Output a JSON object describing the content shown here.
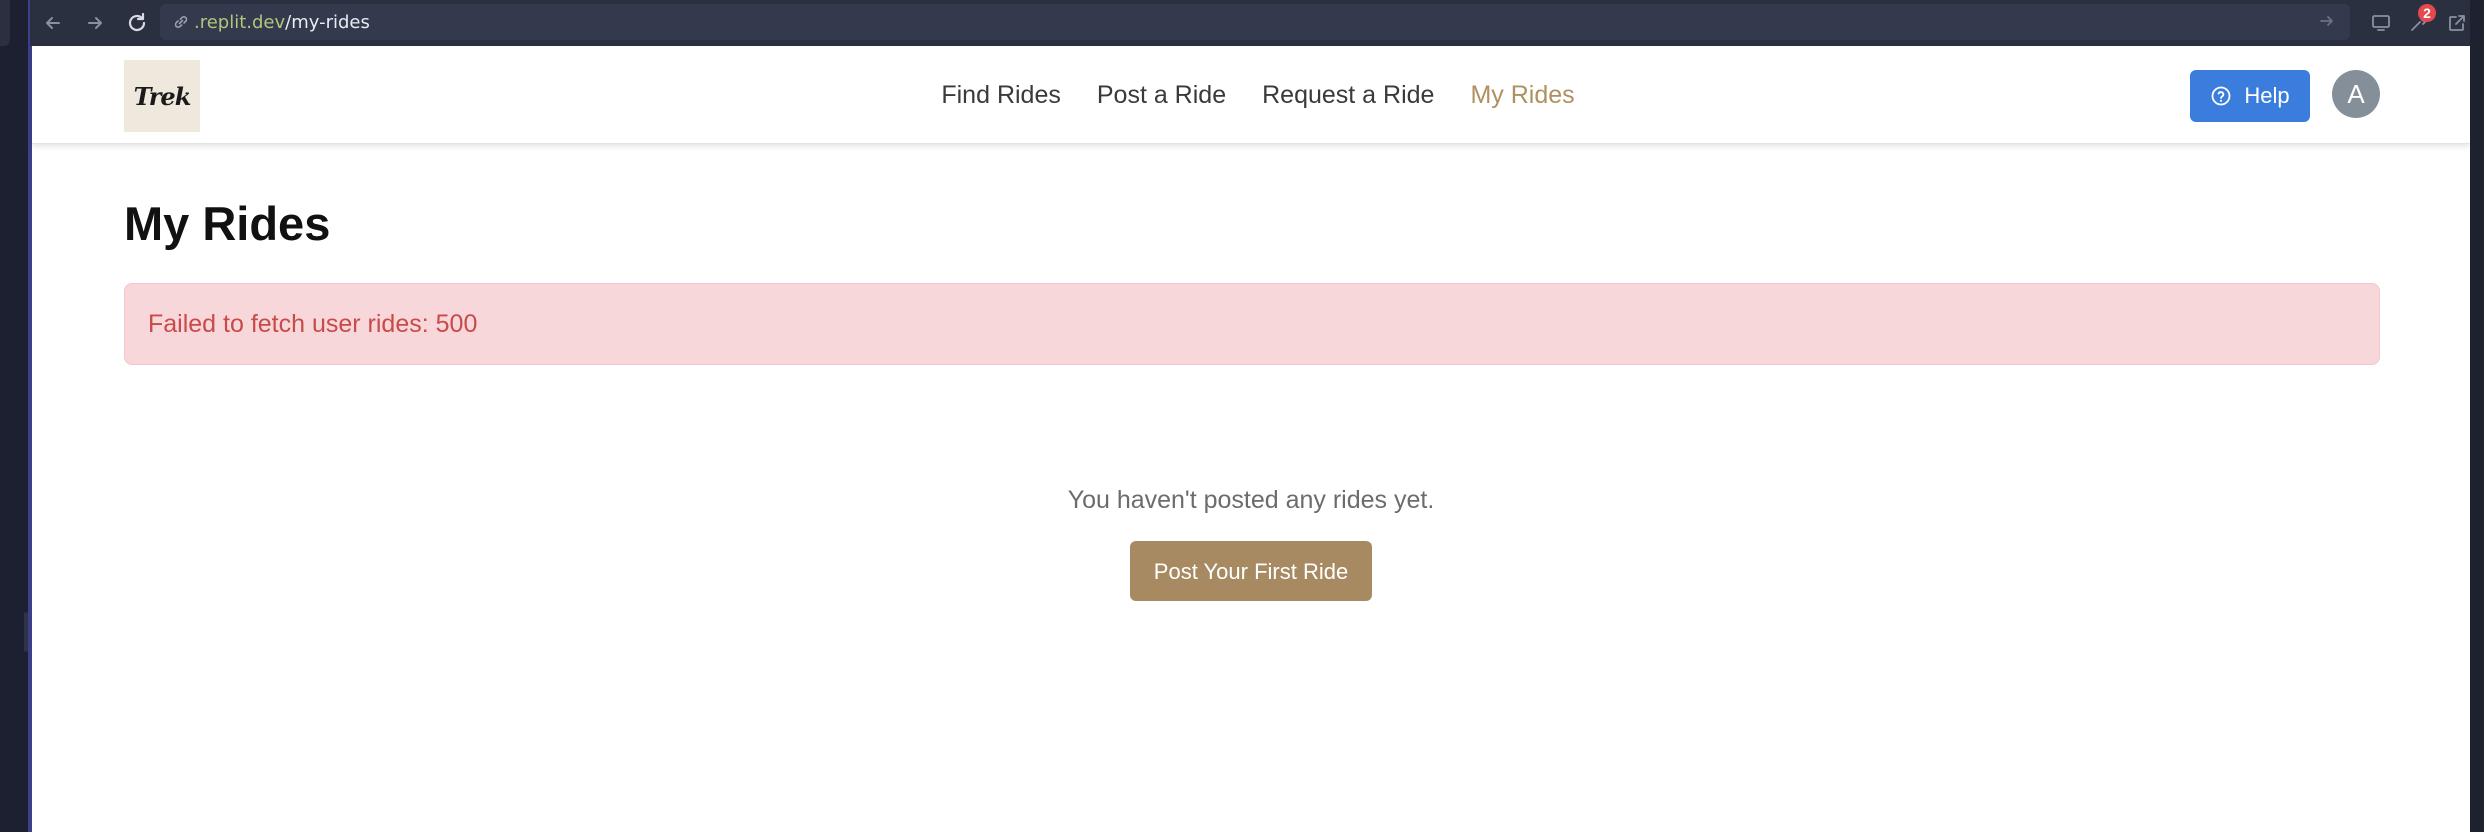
{
  "browser": {
    "url_domain": ".replit.dev",
    "url_path": "/my-rides",
    "notification_count": "2"
  },
  "header": {
    "logo_text": "Trek",
    "nav": [
      {
        "label": "Find Rides",
        "active": false
      },
      {
        "label": "Post a Ride",
        "active": false
      },
      {
        "label": "Request a Ride",
        "active": false
      },
      {
        "label": "My Rides",
        "active": true
      }
    ],
    "help_label": "Help",
    "avatar_initial": "A"
  },
  "main": {
    "title": "My Rides",
    "error_message": "Failed to fetch user rides: 500",
    "empty_message": "You haven't posted any rides yet.",
    "cta_label": "Post Your First Ride"
  },
  "colors": {
    "brand": "#a88a62",
    "nav_active": "#b09060",
    "help_button": "#3b7ddd",
    "alert_bg": "#f8d7da",
    "alert_text": "#c94a4a"
  }
}
